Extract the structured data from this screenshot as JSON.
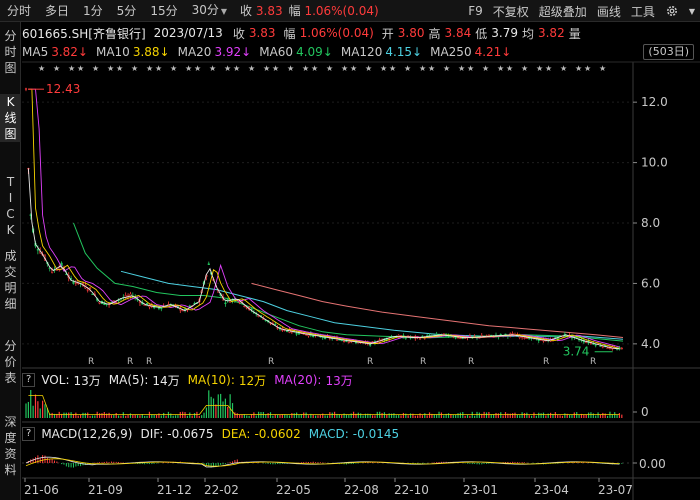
{
  "toolbar": {
    "tabs": [
      {
        "label": "分时",
        "dropdown": false
      },
      {
        "label": "多日",
        "dropdown": false
      },
      {
        "label": "1分",
        "dropdown": false
      },
      {
        "label": "5分",
        "dropdown": false
      },
      {
        "label": "15分",
        "dropdown": false
      },
      {
        "label": "30分",
        "dropdown": true
      }
    ],
    "close_label": "收",
    "close_value": "3.83",
    "change_label": "幅",
    "change_value": "1.06%(0.04)",
    "right_items": [
      "F9",
      "不复权",
      "超级叠加",
      "画线",
      "工具"
    ],
    "settings_icon": "gear-icon"
  },
  "sidebar": {
    "items": [
      "分时图",
      "K线图",
      "TICK",
      "成交明细",
      "分价表",
      "深度资料"
    ],
    "active_index": 1
  },
  "info": {
    "symbol": "601665.SH[齐鲁银行]",
    "date": "2023/07/13",
    "close_label": "收",
    "close_value": "3.83",
    "change_label": "幅",
    "change_value": "1.06%(0.04)",
    "open_label": "开",
    "open_value": "3.80",
    "high_label": "高",
    "high_value": "3.84",
    "low_label": "低",
    "low_value": "3.79",
    "limit_label": "均",
    "limit_value": "3.82",
    "vol_label": "量"
  },
  "ma": {
    "items": [
      {
        "label": "MA5",
        "value": "3.82",
        "arrow": "↓",
        "color": "#ff3b3b"
      },
      {
        "label": "MA10",
        "value": "3.88",
        "arrow": "↓",
        "color": "#f5d300"
      },
      {
        "label": "MA20",
        "value": "3.92",
        "arrow": "↓",
        "color": "#e040fb"
      },
      {
        "label": "MA60",
        "value": "4.09",
        "arrow": "↓",
        "color": "#22c55e"
      },
      {
        "label": "MA120",
        "value": "4.15",
        "arrow": "↓",
        "color": "#4dd0e1"
      },
      {
        "label": "MA250",
        "value": "4.21",
        "arrow": "↓",
        "color": "#ff3b3b"
      }
    ],
    "page_button": "(503日)"
  },
  "price_chart": {
    "y_ticks": [
      "12.0",
      "10.0",
      "8.0",
      "6.0",
      "4.0"
    ],
    "y_values": [
      12.0,
      10.0,
      8.0,
      6.0,
      4.0
    ],
    "ylim": [
      3.3,
      12.8
    ],
    "max_label": "12.43",
    "min_label": "3.74",
    "r_marker": "R",
    "star_marker": "★"
  },
  "volume_panel": {
    "title": "VOL:",
    "value": "13万",
    "ma5_label": "MA(5):",
    "ma5_value": "14万",
    "ma10_label": "MA(10):",
    "ma10_value": "12万",
    "ma20_label": "MA(20):",
    "ma20_value": "13万",
    "y_tick": "0"
  },
  "macd_panel": {
    "title": "MACD(12,26,9)",
    "dif_label": "DIF:",
    "dif_value": "-0.0675",
    "dea_label": "DEA:",
    "dea_value": "-0.0602",
    "macd_label": "MACD:",
    "macd_value": "-0.0145",
    "y_tick": "0.00"
  },
  "x_axis": {
    "labels": [
      "21-06",
      "21-09",
      "21-12",
      "22-02",
      "22-05",
      "22-08",
      "22-10",
      "23-01",
      "23-04",
      "23-07"
    ]
  },
  "chart_data": {
    "type": "candlestick",
    "series": [
      {
        "name": "MA5",
        "color": "#ff3b3b"
      },
      {
        "name": "MA10",
        "color": "#f5d300"
      },
      {
        "name": "MA20",
        "color": "#e040fb"
      },
      {
        "name": "MA60",
        "color": "#22c55e"
      },
      {
        "name": "MA120",
        "color": "#4dd0e1"
      },
      {
        "name": "MA250",
        "color": "#ff3b3b"
      }
    ],
    "price_path": [
      [
        0,
        12.43
      ],
      [
        3,
        8.5
      ],
      [
        8,
        7.3
      ],
      [
        15,
        6.9
      ],
      [
        22,
        6.4
      ],
      [
        30,
        6.6
      ],
      [
        38,
        6.1
      ],
      [
        46,
        6.0
      ],
      [
        54,
        5.8
      ],
      [
        62,
        5.4
      ],
      [
        70,
        5.3
      ],
      [
        80,
        5.5
      ],
      [
        90,
        5.6
      ],
      [
        100,
        5.3
      ],
      [
        112,
        5.2
      ],
      [
        122,
        5.3
      ],
      [
        134,
        5.1
      ],
      [
        146,
        5.4
      ],
      [
        154,
        6.6
      ],
      [
        160,
        5.9
      ],
      [
        168,
        5.4
      ],
      [
        178,
        5.5
      ],
      [
        190,
        5.1
      ],
      [
        202,
        4.8
      ],
      [
        214,
        4.5
      ],
      [
        226,
        4.4
      ],
      [
        240,
        4.3
      ],
      [
        256,
        4.2
      ],
      [
        272,
        4.1
      ],
      [
        290,
        4.0
      ],
      [
        310,
        4.25
      ],
      [
        330,
        4.2
      ],
      [
        350,
        4.3
      ],
      [
        370,
        4.2
      ],
      [
        390,
        4.25
      ],
      [
        410,
        4.3
      ],
      [
        425,
        4.2
      ],
      [
        440,
        4.1
      ],
      [
        455,
        4.3
      ],
      [
        470,
        4.1
      ],
      [
        485,
        3.95
      ],
      [
        495,
        3.85
      ],
      [
        503,
        3.83
      ]
    ],
    "ma60_path": [
      [
        40,
        8.0
      ],
      [
        50,
        7.0
      ],
      [
        60,
        6.5
      ],
      [
        75,
        6.0
      ],
      [
        90,
        5.9
      ],
      [
        110,
        5.7
      ],
      [
        130,
        5.6
      ],
      [
        150,
        5.6
      ],
      [
        170,
        5.5
      ],
      [
        190,
        5.2
      ],
      [
        210,
        4.9
      ],
      [
        230,
        4.6
      ],
      [
        250,
        4.4
      ],
      [
        270,
        4.3
      ],
      [
        300,
        4.25
      ],
      [
        340,
        4.2
      ],
      [
        380,
        4.25
      ],
      [
        420,
        4.3
      ],
      [
        460,
        4.25
      ],
      [
        503,
        4.09
      ]
    ],
    "ma120_path": [
      [
        80,
        6.4
      ],
      [
        100,
        6.2
      ],
      [
        120,
        6.0
      ],
      [
        140,
        5.9
      ],
      [
        160,
        5.8
      ],
      [
        180,
        5.6
      ],
      [
        200,
        5.4
      ],
      [
        220,
        5.1
      ],
      [
        240,
        4.9
      ],
      [
        260,
        4.7
      ],
      [
        280,
        4.6
      ],
      [
        310,
        4.45
      ],
      [
        350,
        4.3
      ],
      [
        390,
        4.25
      ],
      [
        430,
        4.25
      ],
      [
        470,
        4.25
      ],
      [
        503,
        4.15
      ]
    ],
    "ma250_path": [
      [
        190,
        6.0
      ],
      [
        210,
        5.8
      ],
      [
        230,
        5.6
      ],
      [
        250,
        5.4
      ],
      [
        270,
        5.25
      ],
      [
        300,
        5.05
      ],
      [
        330,
        4.9
      ],
      [
        360,
        4.75
      ],
      [
        390,
        4.6
      ],
      [
        420,
        4.5
      ],
      [
        450,
        4.4
      ],
      [
        480,
        4.3
      ],
      [
        503,
        4.21
      ]
    ],
    "x_range": [
      0,
      503
    ]
  }
}
